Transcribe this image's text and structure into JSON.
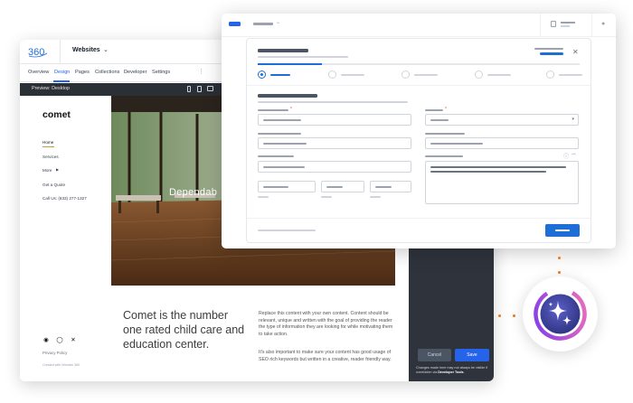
{
  "builder": {
    "site_selector": "Websites",
    "nav": [
      "Overview",
      "Design",
      "Pages",
      "Collections",
      "Developer",
      "Settings"
    ],
    "active_nav": "Design",
    "preview_label": "Preview: Desktop",
    "site": {
      "brand": "comet",
      "menu": [
        "Home",
        "Services",
        "More",
        "Get a Quote",
        "Call Us: (833) 277-1327"
      ],
      "hero_text": "Dependab",
      "headline": "Comet is the number one rated child care and education center.",
      "body_para1": "Replace this content with your own content. Content should be relevant, unique and written with the goal of providing the reader the type of information they are looking for while motivating them to take action.",
      "body_para2": "It's also important to make sure your content has good usage of SEO rich keywords but written in a creative, reader friendly way.",
      "privacy": "Privacy Policy",
      "created_by": "Created with Website 360",
      "social_icons": [
        "facebook-icon",
        "instagram-icon",
        "x-icon"
      ]
    },
    "panel": {
      "cancel": "Cancel",
      "save": "Save",
      "note_prefix": "Changes made here may not always be visible if overridden via ",
      "note_link": "Developer Tools",
      "note_suffix": "."
    }
  },
  "colors": {
    "accent_blue": "#1d6fd6",
    "dark_panel": "#2f343c",
    "ai_gradient_start": "#7c3aed",
    "ai_gradient_end": "#f472b6",
    "orange_dots": "#f97316"
  },
  "form": {
    "steps": 5,
    "current_step": 1,
    "progress_fraction": 0.2
  }
}
